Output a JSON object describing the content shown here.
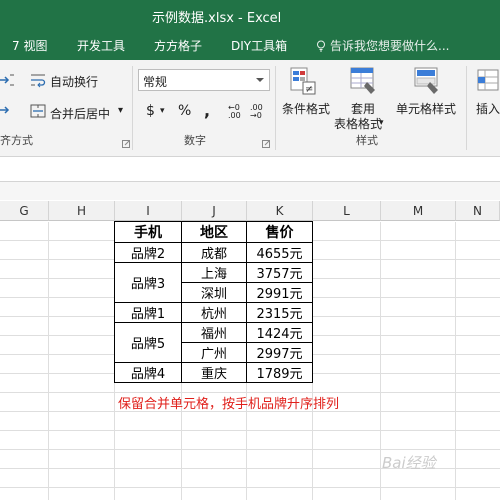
{
  "window": {
    "title": "示例数据.xlsx - Excel"
  },
  "tabs": [
    {
      "label": "7 视图"
    },
    {
      "label": "开发工具"
    },
    {
      "label": "方方格子"
    },
    {
      "label": "DIY工具箱"
    }
  ],
  "tell_me": {
    "placeholder": "告诉我您想要做什么..."
  },
  "ribbon": {
    "wrap_text": "自动换行",
    "merge_center": "合并后居中",
    "merge_center_arrow": "▾",
    "alignment_group": "齐方式",
    "number_format": "常规",
    "currency_symbol": "$",
    "percent_symbol": "%",
    "comma_symbol": ",",
    "increase_decimal": "←0 .00",
    "decrease_decimal": ".00 →0",
    "number_group": "数字",
    "conditional_format": "条件格式",
    "format_as_table_1": "套用",
    "format_as_table_2": "表格格式",
    "cell_styles": "单元格样式",
    "styles_group": "样式",
    "insert": "插入"
  },
  "columns": [
    "G",
    "H",
    "I",
    "J",
    "K",
    "L",
    "M",
    "N"
  ],
  "table": {
    "headers": [
      "手机",
      "地区",
      "售价"
    ],
    "rows": [
      {
        "brand": "品牌2",
        "region": "成都",
        "price": "4655元"
      },
      {
        "brand": "品牌3",
        "region": "上海",
        "price": "3757元"
      },
      {
        "brand": "",
        "region": "深圳",
        "price": "2991元"
      },
      {
        "brand": "品牌1",
        "region": "杭州",
        "price": "2315元"
      },
      {
        "brand": "品牌5",
        "region": "福州",
        "price": "1424元"
      },
      {
        "brand": "",
        "region": "广州",
        "price": "2997元"
      },
      {
        "brand": "品牌4",
        "region": "重庆",
        "price": "1789元"
      }
    ]
  },
  "note": "保留合并单元格，按手机品牌升序排列",
  "watermark": "Bai经验",
  "colors": {
    "excel_green": "#217346",
    "note_red": "#e0201b"
  }
}
